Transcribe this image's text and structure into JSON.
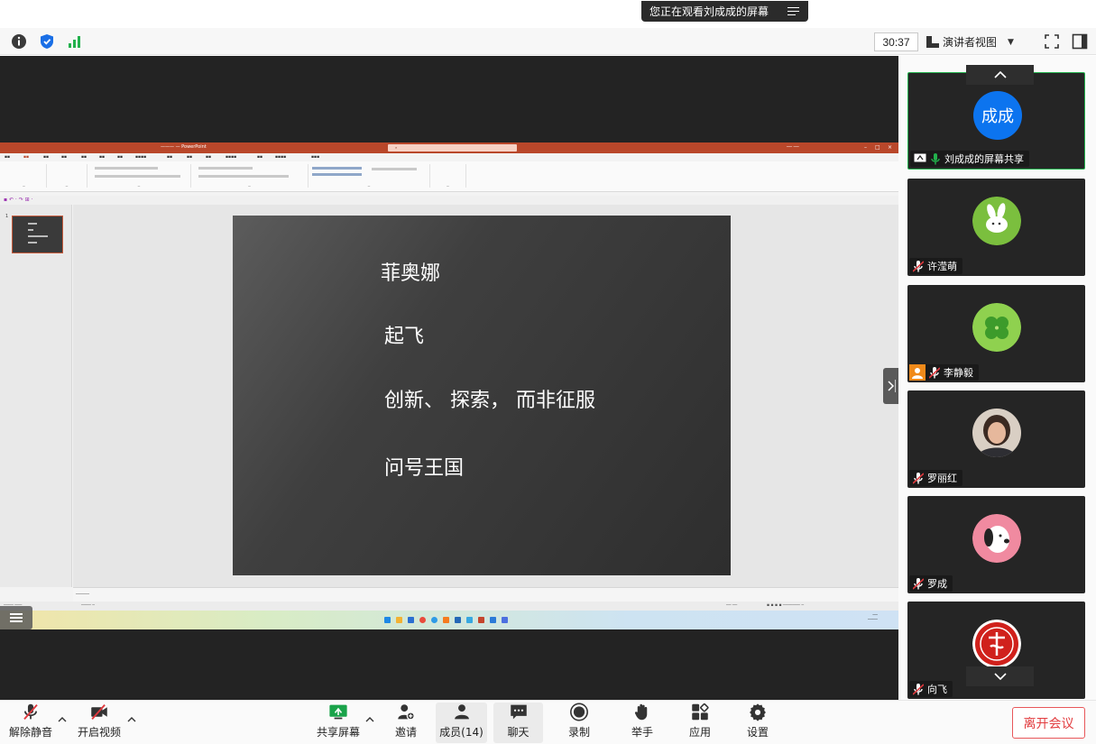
{
  "banner": {
    "text": "您正在观看刘成成的屏幕"
  },
  "topbar": {
    "timer": "30:37",
    "view_mode": "演讲者视图"
  },
  "shared_screen": {
    "app": "PowerPoint",
    "slide_lines": [
      "菲奥娜",
      "起飞",
      "创新、 探索， 而非征服",
      "问号王国"
    ],
    "thumbnail_number": "1"
  },
  "participants": [
    {
      "name": "刘成成的屏幕共享",
      "avatar_text": "成成",
      "avatar_color": "#0c74ef",
      "muted": false,
      "active": true
    },
    {
      "name": "许滢萌",
      "avatar_icon": "bunny-avatar",
      "muted": true,
      "active": false
    },
    {
      "name": "李静毅",
      "avatar_icon": "clover-avatar",
      "muted": true,
      "host_badge": true,
      "active": false
    },
    {
      "name": "罗丽红",
      "avatar_icon": "photo-avatar",
      "muted": true,
      "active": false
    },
    {
      "name": "罗成",
      "avatar_icon": "snoopy-avatar",
      "muted": true,
      "active": false
    },
    {
      "name": "向飞",
      "avatar_icon": "red-seal-avatar",
      "muted": true,
      "active": false
    }
  ],
  "toolbar": {
    "unmute": "解除静音",
    "start_video": "开启视频",
    "share_screen": "共享屏幕",
    "invite": "邀请",
    "members": "成员(14)",
    "chat": "聊天",
    "record": "录制",
    "raise_hand": "举手",
    "apps": "应用",
    "settings": "设置",
    "leave": "离开会议"
  },
  "colors": {
    "accent_green": "#22b14c",
    "leave_red": "#e23c3f",
    "mute_red": "#e0393e",
    "ppt_title": "#b9472a"
  }
}
